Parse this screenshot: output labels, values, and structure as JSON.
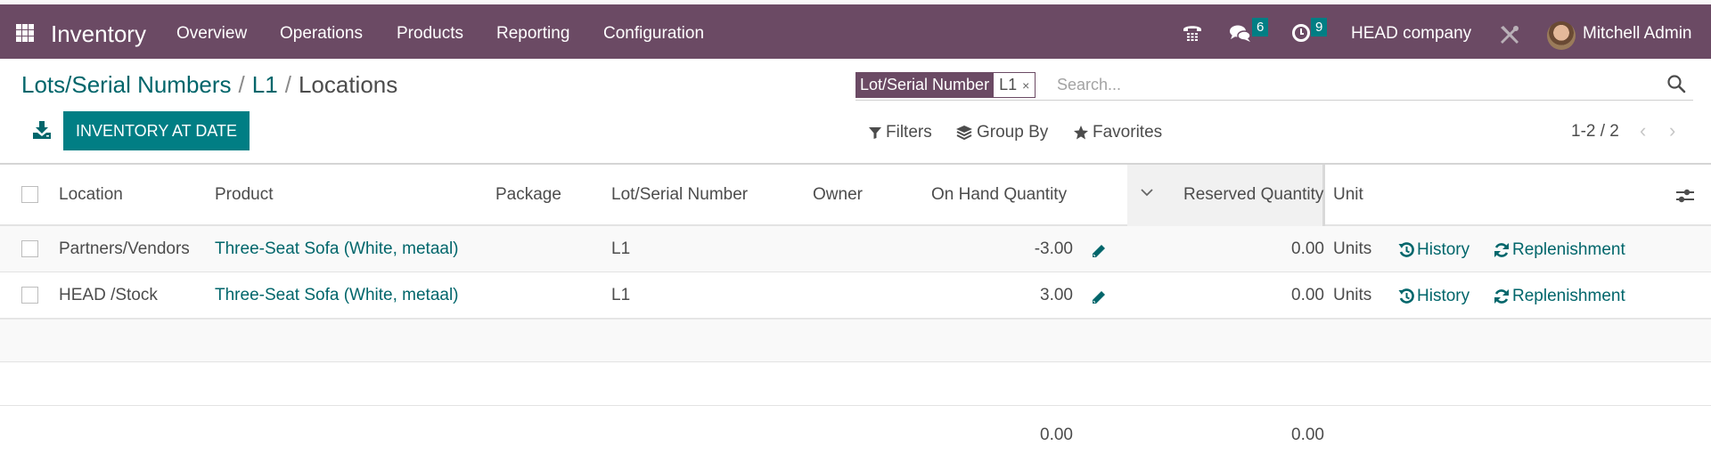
{
  "navbar": {
    "app_name": "Inventory",
    "menu": [
      "Overview",
      "Operations",
      "Products",
      "Reporting",
      "Configuration"
    ],
    "messages_count": "6",
    "activities_count": "9",
    "company": "HEAD company",
    "user": "Mitchell Admin",
    "colors": {
      "navbar": "#6b4a64",
      "badge": "#017e84"
    }
  },
  "breadcrumb": {
    "items": [
      "Lots/Serial Numbers",
      "L1"
    ],
    "current": "Locations",
    "separator": "/"
  },
  "actions": {
    "inventory_at_date": "INVENTORY AT DATE",
    "primary_color": "#017e84"
  },
  "search": {
    "facet_label": "Lot/Serial Number",
    "facet_value": "L1",
    "facet_remove": "×",
    "placeholder": "Search...",
    "value": ""
  },
  "filters": {
    "filters_label": "Filters",
    "groupby_label": "Group By",
    "favorites_label": "Favorites"
  },
  "pager": {
    "value": "1-2 / 2",
    "prev": "‹",
    "next": "›"
  },
  "table": {
    "columns": [
      "Location",
      "Product",
      "Package",
      "Lot/Serial Number",
      "Owner",
      "On Hand Quantity",
      "Reserved Quantity",
      "Unit"
    ],
    "rows": [
      {
        "location": "Partners/Vendors",
        "product": "Three-Seat Sofa (White, metaal)",
        "package": "",
        "lot": "L1",
        "owner": "",
        "on_hand": "-3.00",
        "reserved": "0.00",
        "unit": "Units",
        "history": "History",
        "replenishment": "Replenishment"
      },
      {
        "location": "HEAD /Stock",
        "product": "Three-Seat Sofa (White, metaal)",
        "package": "",
        "lot": "L1",
        "owner": "",
        "on_hand": "3.00",
        "reserved": "0.00",
        "unit": "Units",
        "history": "History",
        "replenishment": "Replenishment"
      }
    ],
    "totals": {
      "on_hand": "0.00",
      "reserved": "0.00"
    }
  }
}
